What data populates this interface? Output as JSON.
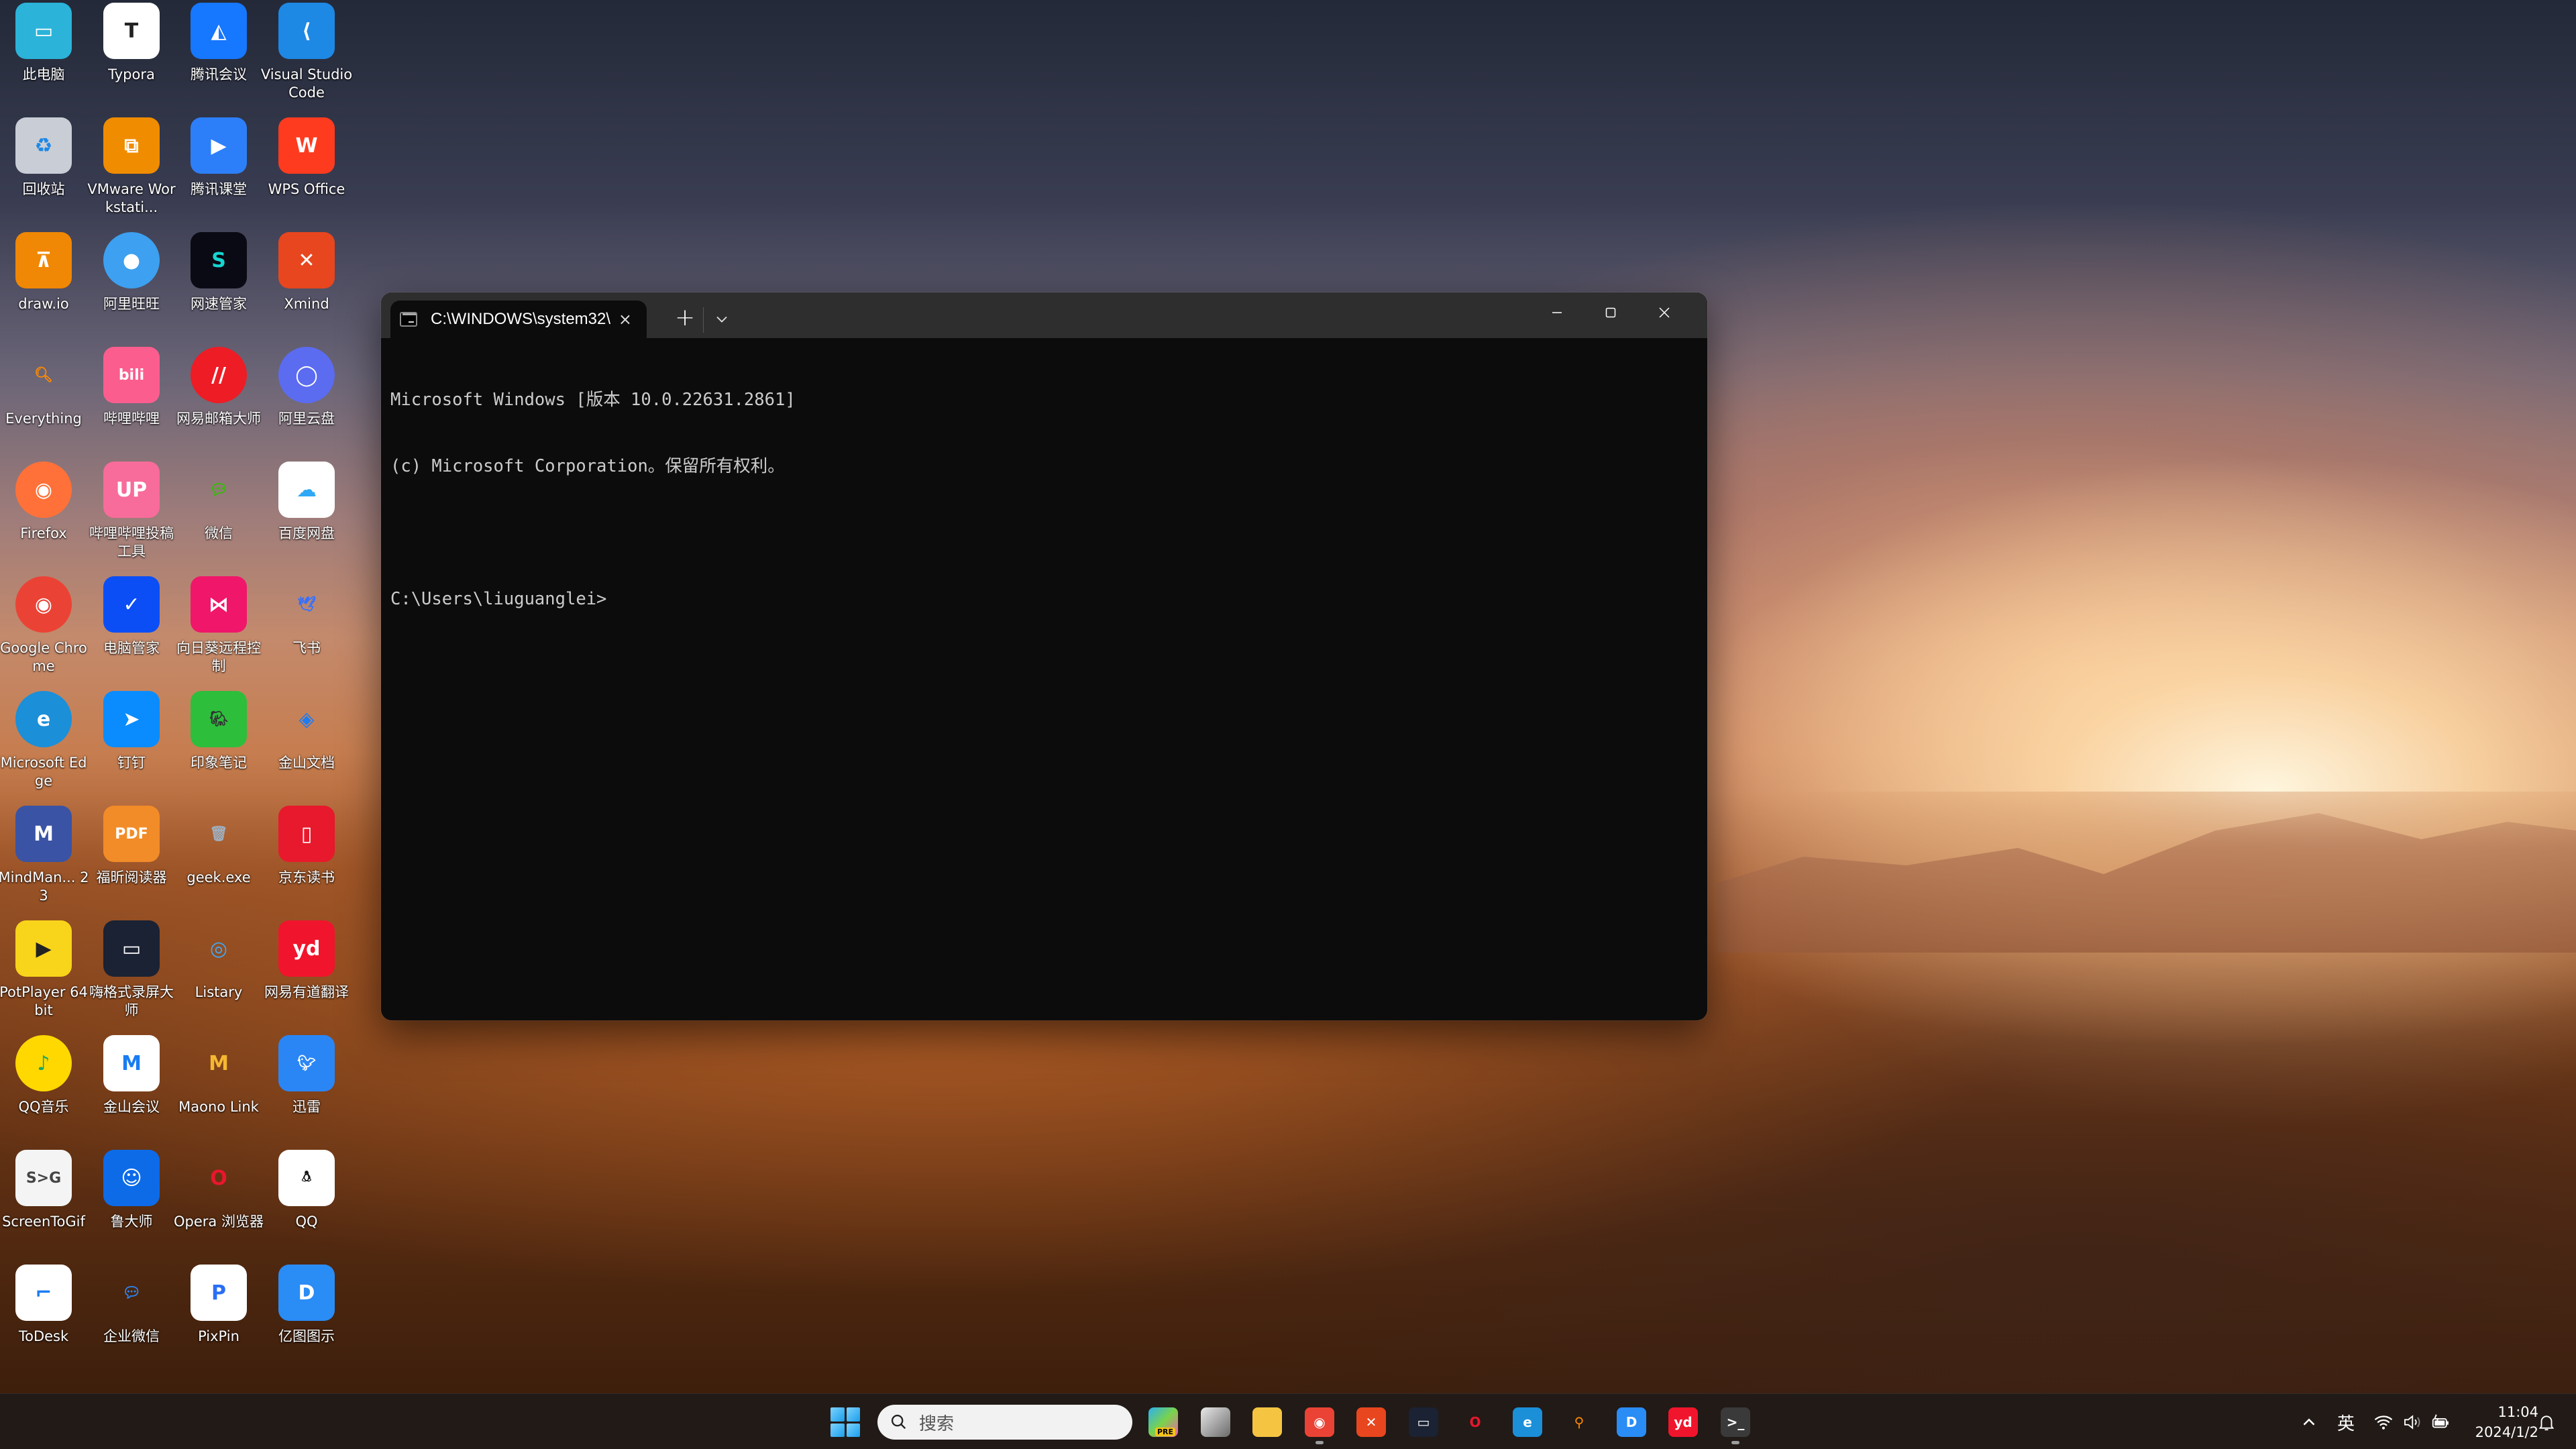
{
  "desktop": {
    "icons": [
      {
        "label": "此电脑",
        "icon": "computer-icon",
        "bg": "#2bb3d9",
        "glyph": "▭"
      },
      {
        "label": "Typora",
        "icon": "typora-icon",
        "bg": "#ffffff",
        "glyph": "T",
        "fg": "#222222"
      },
      {
        "label": "腾讯会议",
        "icon": "tencent-meeting-icon",
        "bg": "#1677ff",
        "glyph": "◭"
      },
      {
        "label": "Visual Studio Code",
        "icon": "vscode-icon",
        "bg": "#1e88e5",
        "glyph": "⟨"
      },
      {
        "label": "回收站",
        "icon": "recycle-bin-icon",
        "bg": "#c9ced6",
        "glyph": "♻",
        "fg": "#1e88e5"
      },
      {
        "label": "VMware Workstati...",
        "icon": "vmware-icon",
        "bg": "#f08c00",
        "glyph": "⧉"
      },
      {
        "label": "腾讯课堂",
        "icon": "tencent-classroom-icon",
        "bg": "#2d7ff9",
        "glyph": "▶"
      },
      {
        "label": "WPS Office",
        "icon": "wps-icon",
        "bg": "#ff3b1f",
        "glyph": "W"
      },
      {
        "label": "draw.io",
        "icon": "drawio-icon",
        "bg": "#f08705",
        "glyph": "⊼"
      },
      {
        "label": "阿里旺旺",
        "icon": "aliwangwang-icon",
        "bg": "#3da0f0",
        "glyph": "●",
        "round": true
      },
      {
        "label": "网速管家",
        "icon": "net-speed-icon",
        "bg": "#0a0a14",
        "glyph": "S",
        "fg": "#16d6d0"
      },
      {
        "label": "Xmind",
        "icon": "xmind-icon",
        "bg": "#e8461e",
        "glyph": "✕"
      },
      {
        "label": "Everything",
        "icon": "everything-icon",
        "bg": "transparent",
        "glyph": "🔍︎",
        "fg": "#ff8a00"
      },
      {
        "label": "哔哩哔哩",
        "icon": "bilibili-icon",
        "bg": "#fb5e8e",
        "glyph": "bili"
      },
      {
        "label": "网易邮箱大师",
        "icon": "netease-mail-icon",
        "bg": "#ee1c25",
        "glyph": "//",
        "round": true
      },
      {
        "label": "阿里云盘",
        "icon": "aliyun-drive-icon",
        "bg": "#5b6cf0",
        "glyph": "◯",
        "round": true
      },
      {
        "label": "Firefox",
        "icon": "firefox-icon",
        "bg": "#ff7139",
        "glyph": "◉",
        "round": true
      },
      {
        "label": "哔哩哔哩投稿工具",
        "icon": "bilibili-upload-icon",
        "bg": "#f76c9a",
        "glyph": "UP"
      },
      {
        "label": "微信",
        "icon": "wechat-icon",
        "bg": "transparent",
        "glyph": "💬︎",
        "fg": "#2dc100"
      },
      {
        "label": "百度网盘",
        "icon": "baidu-netdisk-icon",
        "bg": "#ffffff",
        "glyph": "☁",
        "fg": "#2fa8f5"
      },
      {
        "label": "Google Chrome",
        "icon": "chrome-icon",
        "bg": "#ea4335",
        "glyph": "◉",
        "round": true
      },
      {
        "label": "电脑管家",
        "icon": "pc-manager-icon",
        "bg": "#0c4ef5",
        "glyph": "✓"
      },
      {
        "label": "向日葵远程控制",
        "icon": "sunlogin-icon",
        "bg": "#f0166a",
        "glyph": "⋈"
      },
      {
        "label": "飞书",
        "icon": "feishu-icon",
        "bg": "transparent",
        "glyph": "🕊︎",
        "fg": "#3370ff"
      },
      {
        "label": "Microsoft Edge",
        "icon": "edge-icon",
        "bg": "#1b8fd8",
        "glyph": "e",
        "round": true
      },
      {
        "label": "钉钉",
        "icon": "dingtalk-icon",
        "bg": "#0a8cff",
        "glyph": "➤"
      },
      {
        "label": "印象笔记",
        "icon": "evernote-icon",
        "bg": "#2dbe3c",
        "glyph": "🐘︎",
        "fg": "#333333"
      },
      {
        "label": "金山文档",
        "icon": "kdocs-icon",
        "bg": "transparent",
        "glyph": "◈",
        "fg": "#1e7cf2"
      },
      {
        "label": "MindMan... 23",
        "icon": "mindmanager-icon",
        "bg": "#3a53a4",
        "glyph": "M"
      },
      {
        "label": "福昕阅读器",
        "icon": "foxit-reader-icon",
        "bg": "#f28c28",
        "glyph": "PDF"
      },
      {
        "label": "geek.exe",
        "icon": "geek-uninstaller-icon",
        "bg": "transparent",
        "glyph": "🗑︎",
        "fg": "#9fb0c0"
      },
      {
        "label": "京东读书",
        "icon": "jd-read-icon",
        "bg": "#e8192c",
        "glyph": "▯"
      },
      {
        "label": "PotPlayer 64 bit",
        "icon": "potplayer-icon",
        "bg": "#f8d41a",
        "glyph": "▶",
        "fg": "#222222"
      },
      {
        "label": "嗨格式录屏大师",
        "icon": "screen-recorder-icon",
        "bg": "#1b2233",
        "glyph": "▭"
      },
      {
        "label": "Listary",
        "icon": "listary-icon",
        "bg": "transparent",
        "glyph": "◎",
        "fg": "#3fa9f5"
      },
      {
        "label": "网易有道翻译",
        "icon": "youdao-icon",
        "bg": "#f0152c",
        "glyph": "yd"
      },
      {
        "label": "QQ音乐",
        "icon": "qq-music-icon",
        "bg": "#ffd800",
        "glyph": "♪",
        "fg": "#1aa864",
        "round": true
      },
      {
        "label": "金山会议",
        "icon": "kingsoft-meeting-icon",
        "bg": "#ffffff",
        "glyph": "M",
        "fg": "#1a7cf2"
      },
      {
        "label": "Maono Link",
        "icon": "maono-link-icon",
        "bg": "transparent",
        "glyph": "M",
        "fg": "#f5b730"
      },
      {
        "label": "迅雷",
        "icon": "xunlei-icon",
        "bg": "#2a86f5",
        "glyph": "🐦︎"
      },
      {
        "label": "ScreenToGif",
        "icon": "screentogif-icon",
        "bg": "#f4f4f4",
        "glyph": "S>G",
        "fg": "#444444"
      },
      {
        "label": "鲁大师",
        "icon": "ludashi-icon",
        "bg": "#0d6be8",
        "glyph": "☺"
      },
      {
        "label": "Opera 浏览器",
        "icon": "opera-icon",
        "bg": "transparent",
        "glyph": "O",
        "fg": "#e8172c"
      },
      {
        "label": "QQ",
        "icon": "qq-icon",
        "bg": "#ffffff",
        "glyph": "🐧︎",
        "fg": "#111111"
      },
      {
        "label": "ToDesk",
        "icon": "todesk-icon",
        "bg": "#ffffff",
        "glyph": "⌐",
        "fg": "#1a7cf2"
      },
      {
        "label": "企业微信",
        "icon": "wecom-icon",
        "bg": "transparent",
        "glyph": "💬︎",
        "fg": "#2a86f5"
      },
      {
        "label": "PixPin",
        "icon": "pixpin-icon",
        "bg": "#ffffff",
        "glyph": "P",
        "fg": "#2a6ef5"
      },
      {
        "label": "亿图图示",
        "icon": "edraw-icon",
        "bg": "#2a8cf5",
        "glyph": "D"
      }
    ]
  },
  "terminal": {
    "tab_title": "C:\\WINDOWS\\system32\\",
    "tab_close": "×",
    "new_tab": "+",
    "lines": [
      "Microsoft Windows [版本 10.0.22631.2861]",
      "(c) Microsoft Corporation。保留所有权利。",
      "",
      "C:\\Users\\liuguanglei>"
    ]
  },
  "taskbar": {
    "search_placeholder": "搜索",
    "pinned": [
      {
        "name": "copilot-icon",
        "bg": "linear-gradient(135deg,#2bb0f0,#7bd34a,#f25fb0)",
        "glyph": "",
        "badge": "PRE"
      },
      {
        "name": "task-view-icon",
        "bg": "linear-gradient(135deg,#e8e8e8,#6a6a6a)",
        "glyph": ""
      },
      {
        "name": "file-explorer-icon",
        "bg": "#f5c542",
        "glyph": ""
      },
      {
        "name": "chrome-icon",
        "bg": "#ea4335",
        "glyph": "◉",
        "active": true
      },
      {
        "name": "xmind-icon",
        "bg": "#e8461e",
        "glyph": "✕"
      },
      {
        "name": "screen-recorder-icon",
        "bg": "#1b2233",
        "glyph": "▭"
      },
      {
        "name": "opera-icon",
        "bg": "transparent",
        "glyph": "O",
        "fg": "#e8172c"
      },
      {
        "name": "edge-icon",
        "bg": "#1b8fd8",
        "glyph": "e"
      },
      {
        "name": "everything-icon",
        "bg": "transparent",
        "glyph": "⚲",
        "fg": "#ff8a00"
      },
      {
        "name": "edraw-icon",
        "bg": "#2a8cf5",
        "glyph": "D"
      },
      {
        "name": "youdao-icon",
        "bg": "#f0152c",
        "glyph": "yd"
      },
      {
        "name": "terminal-icon",
        "bg": "#3a3a3a",
        "glyph": ">_",
        "active": true
      }
    ],
    "tray": {
      "ime": "英",
      "time": "11:04",
      "date": "2024/1/2"
    }
  },
  "colors": {
    "terminal_bg": "#0c0c0c",
    "titlebar_bg": "#2e2e2e",
    "terminal_text": "#cccccc",
    "taskbar_bg": "#201a18",
    "accent": "#1a9eea"
  }
}
